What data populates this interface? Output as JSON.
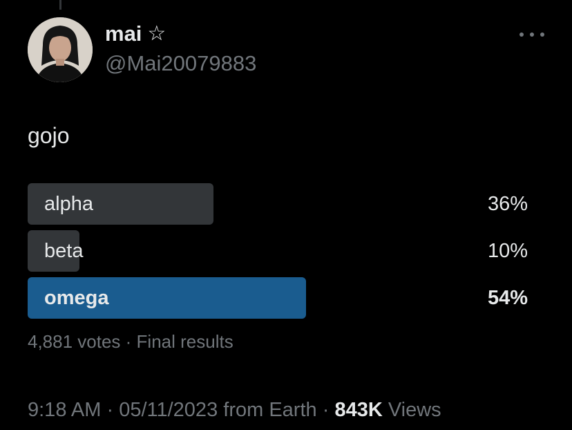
{
  "author": {
    "display_name": "mai",
    "badge_icon": "star-outline-icon",
    "badge_glyph": "☆",
    "handle": "@Mai20079883"
  },
  "tweet": {
    "text": "gojo"
  },
  "poll": {
    "options": [
      {
        "label": "alpha",
        "percent_text": "36%",
        "percent": 36,
        "winner": false
      },
      {
        "label": "beta",
        "percent_text": "10%",
        "percent": 10,
        "winner": false
      },
      {
        "label": "omega",
        "percent_text": "54%",
        "percent": 54,
        "winner": true
      }
    ],
    "summary": "4,881 votes · Final results"
  },
  "footer": {
    "time": "9:18 AM",
    "separator": "·",
    "date": "05/11/2023",
    "source": "from Earth",
    "views_count": "843K",
    "views_label": "Views"
  },
  "colors": {
    "background": "#000000",
    "primary_text": "#e7e9ea",
    "secondary_text": "#71767b",
    "poll_bar": "#333639",
    "poll_winner_bar": "#1a5c8f"
  }
}
